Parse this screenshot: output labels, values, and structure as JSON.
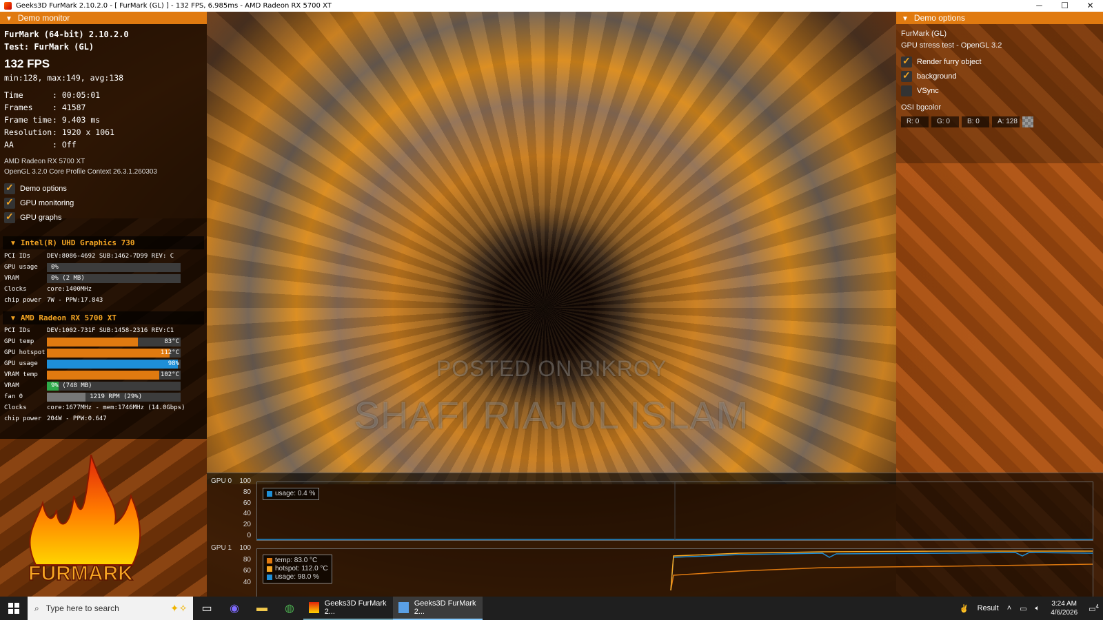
{
  "window": {
    "title": "Geeks3D FurMark 2.10.2.0 - [ FurMark (GL) ] - 132 FPS, 6.985ms - AMD Radeon RX 5700 XT",
    "min_icon": "minimize-icon",
    "max_icon": "maximize-icon",
    "close_icon": "close-icon"
  },
  "watermark": {
    "line1": "POSTED ON BIKROY",
    "line2": "SHAFI RIAJUL ISLAM"
  },
  "demo_monitor": {
    "header": "Demo monitor",
    "app": "FurMark (64-bit) 2.10.2.0",
    "test": "Test: FurMark (GL)",
    "fps": "132 FPS",
    "minmax": "min:128, max:149, avg:138",
    "stats": [
      {
        "k": "Time",
        "v": ": 00:05:01"
      },
      {
        "k": "Frames",
        "v": ": 41587"
      },
      {
        "k": "Frame time",
        "v": ": 9.403 ms"
      },
      {
        "k": "Resolution",
        "v": ": 1920 x 1061"
      },
      {
        "k": "AA",
        "v": ": Off"
      }
    ],
    "gpu_name": "AMD Radeon RX 5700 XT",
    "gl_context": "OpenGL 3.2.0 Core Profile Context 26.3.1.260303",
    "checks": [
      {
        "label": "Demo options",
        "checked": true
      },
      {
        "label": "GPU monitoring",
        "checked": true
      },
      {
        "label": "GPU graphs",
        "checked": true
      }
    ]
  },
  "gpu0": {
    "name": "Intel(R) UHD Graphics 730",
    "rows": [
      {
        "k": "PCI IDs",
        "v": "DEV:8086-4692 SUB:1462-7D99 REV: C"
      },
      {
        "k": "GPU usage",
        "v": "0%",
        "bar": 0.0,
        "color": "#3c3c3c"
      },
      {
        "k": "VRAM",
        "v": "0% (2 MB)",
        "bar": 0.0,
        "color": "#3c3c3c"
      },
      {
        "k": "Clocks",
        "v": "core:1400MHz"
      },
      {
        "k": "chip power",
        "v": "7W - PPW:17.843"
      }
    ]
  },
  "gpu1": {
    "name": "AMD Radeon RX 5700 XT",
    "rows": [
      {
        "k": "PCI IDs",
        "v": "DEV:1002-731F SUB:1458-2316 REV:C1"
      },
      {
        "k": "GPU temp",
        "v": "83°C",
        "bar": 0.68,
        "color": "#e07a10"
      },
      {
        "k": "GPU hotspot",
        "v": "112°C",
        "bar": 0.92,
        "color": "#e07a10"
      },
      {
        "k": "GPU usage",
        "v": "98%",
        "bar": 0.98,
        "color": "#1e8fd8"
      },
      {
        "k": "VRAM temp",
        "v": "102°C",
        "bar": 0.84,
        "color": "#e07a10"
      },
      {
        "k": "VRAM",
        "v": "9% (748 MB)",
        "bar": 0.09,
        "color": "#2eaa4a"
      },
      {
        "k": "fan 0",
        "v": "1219 RPM (29%)",
        "bar": 0.29,
        "color": "#777777"
      },
      {
        "k": "Clocks",
        "v": "core:1677MHz - mem:1746MHz (14.0Gbps)"
      },
      {
        "k": "chip power",
        "v": "204W - PPW:0.647"
      }
    ]
  },
  "logo": {
    "text": "FURMARK"
  },
  "demo_options": {
    "header": "Demo options",
    "line1": "FurMark (GL)",
    "line2": "GPU stress test - OpenGL 3.2",
    "checks": [
      {
        "label": "Render furry object",
        "checked": true
      },
      {
        "label": "background",
        "checked": true
      },
      {
        "label": "VSync",
        "checked": false
      }
    ],
    "osi_label": "OSI bgcolor",
    "color_fields": [
      {
        "label": "R: 0"
      },
      {
        "label": "G: 0"
      },
      {
        "label": "B: 0"
      },
      {
        "label": "A: 128"
      }
    ]
  },
  "graphs": {
    "gpu0": {
      "label": "GPU 0",
      "axis": [
        "100",
        "80",
        "60",
        "40",
        "20",
        "0"
      ],
      "legend": [
        {
          "text": "usage: 0.4 %",
          "color": "#1e8fd8"
        }
      ]
    },
    "gpu1": {
      "label": "GPU 1",
      "axis": [
        "100",
        "80",
        "60",
        "40"
      ],
      "legend": [
        {
          "text": "temp: 83.0 °C",
          "color": "#e07a10"
        },
        {
          "text": "hotspot: 112.0 °C",
          "color": "#f5a623"
        },
        {
          "text": "usage: 98.0 %",
          "color": "#1e8fd8"
        }
      ]
    }
  },
  "taskbar": {
    "search_placeholder": "Type here to search",
    "apps": [
      {
        "label": "Geeks3D FurMark 2...",
        "active": false
      },
      {
        "label": "Geeks3D FurMark 2...",
        "active": true
      }
    ],
    "tray_result": "Result",
    "time": "3:24 AM",
    "date": "4/6/2026",
    "notifications": "4"
  }
}
